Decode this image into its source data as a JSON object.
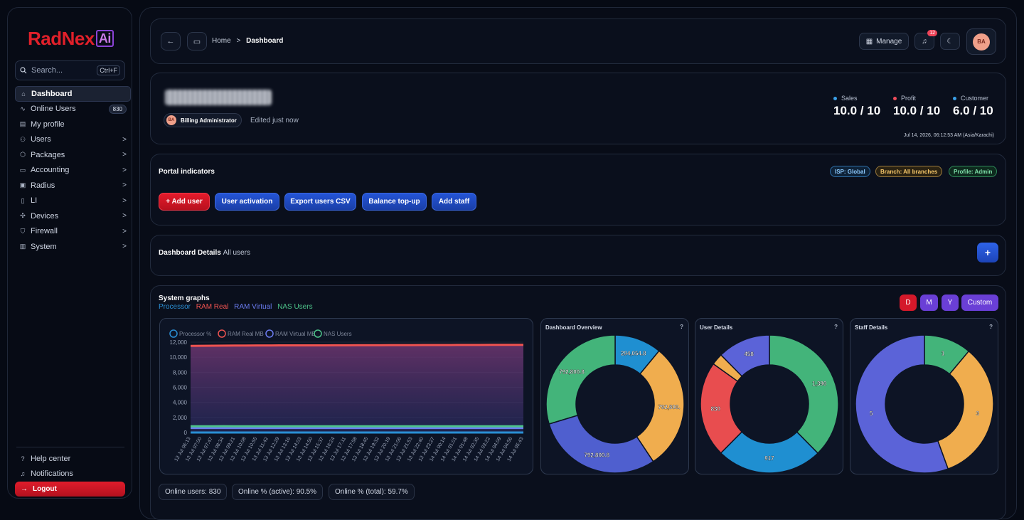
{
  "brand": {
    "part1": "RadNex",
    "part2": "Ai"
  },
  "search": {
    "placeholder": "Search...",
    "shortcut": "Ctrl+F"
  },
  "sidebar": {
    "items": [
      {
        "label": "Dashboard",
        "icon": "home-icon",
        "active": true
      },
      {
        "label": "Online Users",
        "icon": "activity-icon",
        "badge": "830"
      },
      {
        "label": "My profile",
        "icon": "id-card-icon"
      },
      {
        "label": "Users",
        "icon": "users-icon",
        "chevron": ">"
      },
      {
        "label": "Packages",
        "icon": "package-icon",
        "chevron": ">"
      },
      {
        "label": "Accounting",
        "icon": "wallet-icon",
        "chevron": ">"
      },
      {
        "label": "Radius",
        "icon": "radius-icon",
        "chevron": ">"
      },
      {
        "label": "LI",
        "icon": "document-icon",
        "chevron": ">"
      },
      {
        "label": "Devices",
        "icon": "devices-icon",
        "chevron": ">"
      },
      {
        "label": "Firewall",
        "icon": "shield-icon",
        "chevron": ">"
      },
      {
        "label": "System",
        "icon": "server-icon",
        "chevron": ">"
      }
    ],
    "bottom": [
      {
        "label": "Help center",
        "icon": "help-icon"
      },
      {
        "label": "Notifications",
        "icon": "bell-icon"
      }
    ],
    "logout": "Logout"
  },
  "header": {
    "breadcrumb_home": "Home",
    "breadcrumb_sep": ">",
    "breadcrumb_current": "Dashboard",
    "manage": "Manage",
    "notif_count": "12",
    "avatar": "BA"
  },
  "profile": {
    "role": "Billing Administrator",
    "role_avatar": "BA",
    "edited": "Edited just now",
    "stats": [
      {
        "label": "Sales",
        "value": "10.0 / 10",
        "color": "#3aa0e8"
      },
      {
        "label": "Profit",
        "value": "10.0 / 10",
        "color": "#ef4c5a"
      },
      {
        "label": "Customer",
        "value": "6.0 / 10",
        "color": "#3aa0e8"
      }
    ],
    "timestamp": "Jul 14, 2026, 06:12:53 AM (Asia/Karachi)"
  },
  "portal": {
    "title": "Portal indicators",
    "tags": [
      "ISP: Global",
      "Branch: All branches",
      "Profile: Admin"
    ],
    "actions": [
      "+ Add user",
      "User activation",
      "Export users CSV",
      "Balance top-up",
      "Add staff"
    ]
  },
  "details": {
    "title": "Dashboard Details",
    "subtitle": "All users",
    "add": "+"
  },
  "graphs": {
    "title": "System graphs",
    "series_labels": [
      "Processor",
      "RAM Real",
      "RAM Virtual",
      "NAS Users"
    ],
    "ranges": [
      "D",
      "M",
      "Y",
      "Custom"
    ]
  },
  "chart_data": [
    {
      "type": "line",
      "title": "",
      "legend": [
        "Processor %",
        "RAM Real MB",
        "RAM Virtual MB",
        "NAS Users"
      ],
      "ylim": [
        0,
        12000
      ],
      "yticks": [
        "0",
        "2,000",
        "4,000",
        "6,000",
        "8,000",
        "10,000",
        "12,000"
      ],
      "x": [
        "13 Jul 06:13",
        "13 Jul 07:00",
        "13 Jul 07:47",
        "13 Jul 08:34",
        "13 Jul 09:21",
        "13 Jul 10:08",
        "13 Jul 10:55",
        "13 Jul 11:42",
        "13 Jul 12:29",
        "13 Jul 13:16",
        "13 Jul 14:03",
        "13 Jul 14:50",
        "13 Jul 15:37",
        "13 Jul 16:24",
        "13 Jul 17:11",
        "13 Jul 17:58",
        "13 Jul 18:45",
        "13 Jul 19:32",
        "13 Jul 20:19",
        "13 Jul 21:06",
        "13 Jul 21:53",
        "13 Jul 22:40",
        "13 Jul 23:27",
        "14 Jul 00:14",
        "14 Jul 01:01",
        "14 Jul 01:48",
        "14 Jul 02:35",
        "14 Jul 03:22",
        "14 Jul 04:09",
        "14 Jul 04:56",
        "14 Jul 05:43"
      ],
      "series": [
        {
          "name": "Processor %",
          "color": "#2a8fd4",
          "values": [
            0,
            0,
            0,
            0,
            0,
            0,
            0,
            0,
            0,
            0,
            0,
            0,
            0,
            0,
            0,
            0,
            0,
            0,
            0,
            0,
            0,
            0,
            0,
            0,
            0,
            0,
            0,
            0,
            0,
            0,
            0
          ]
        },
        {
          "name": "RAM Real MB",
          "color": "#ef5350",
          "values": [
            11500,
            11520,
            11530,
            11540,
            11550,
            11550,
            11560,
            11560,
            11570,
            11570,
            11580,
            11580,
            11580,
            11590,
            11590,
            11600,
            11600,
            11600,
            11610,
            11610,
            11610,
            11620,
            11620,
            11620,
            11630,
            11630,
            11630,
            11640,
            11640,
            11650,
            11650
          ]
        },
        {
          "name": "RAM Virtual MB",
          "color": "#6b7cf0",
          "values": [
            600,
            600,
            600,
            600,
            600,
            600,
            600,
            600,
            600,
            600,
            600,
            600,
            600,
            600,
            600,
            600,
            600,
            600,
            600,
            600,
            600,
            600,
            600,
            600,
            600,
            600,
            600,
            600,
            600,
            600,
            600
          ]
        },
        {
          "name": "NAS Users",
          "color": "#4dc38a",
          "values": [
            830,
            830,
            830,
            840,
            830,
            830,
            830,
            830,
            830,
            830,
            830,
            830,
            830,
            830,
            830,
            830,
            830,
            830,
            830,
            830,
            830,
            830,
            830,
            830,
            830,
            830,
            830,
            830,
            830,
            830,
            830
          ]
        }
      ]
    },
    {
      "type": "pie",
      "title": "Dashboard Overview",
      "values": [
        294054.8,
        792800.8,
        792800.8,
        792800.8
      ],
      "labels": [
        "294,054.8",
        "792,800.",
        "792,800.8",
        "792,800.8"
      ],
      "colors": [
        "#1f8fd1",
        "#f0ad4e",
        "#4f5fcf",
        "#43b47a"
      ]
    },
    {
      "type": "pie",
      "title": "User Details",
      "values": [
        1390,
        917,
        830,
        100,
        458
      ],
      "labels": [
        "1,390",
        "917",
        "830",
        "",
        "458"
      ],
      "colors": [
        "#43b47a",
        "#1f8fd1",
        "#e84d4f",
        "#f0ad4e",
        "#5b63d8"
      ]
    },
    {
      "type": "pie",
      "title": "Staff Details",
      "values": [
        1,
        3,
        5
      ],
      "labels": [
        "1",
        "3",
        "5"
      ],
      "colors": [
        "#43b47a",
        "#f0ad4e",
        "#5b63d8"
      ]
    }
  ],
  "footer_pills": [
    "Online users: 830",
    "Online % (active): 90.5%",
    "Online % (total): 59.7%"
  ],
  "help": "?"
}
